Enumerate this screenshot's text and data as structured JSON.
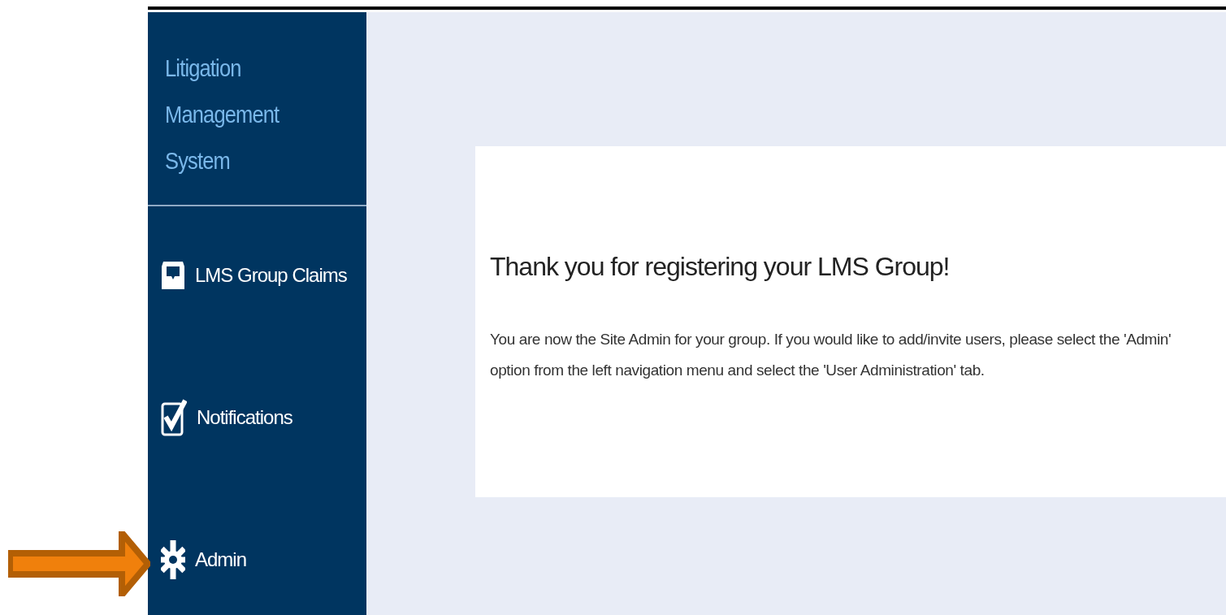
{
  "sidebar": {
    "title_lines": [
      "Litigation",
      "Management",
      "System"
    ],
    "items": [
      {
        "label": "LMS Group Claims",
        "kind": "inbox"
      },
      {
        "label": "Notifications",
        "kind": "check"
      },
      {
        "label": "Admin",
        "kind": "gear"
      }
    ]
  },
  "card": {
    "heading": "Thank you for registering your LMS Group!",
    "message": "You are now the Site Admin for your group. If you would like to add/invite users, please select the 'Admin' option from the left navigation menu and select the 'User Administration' tab."
  }
}
